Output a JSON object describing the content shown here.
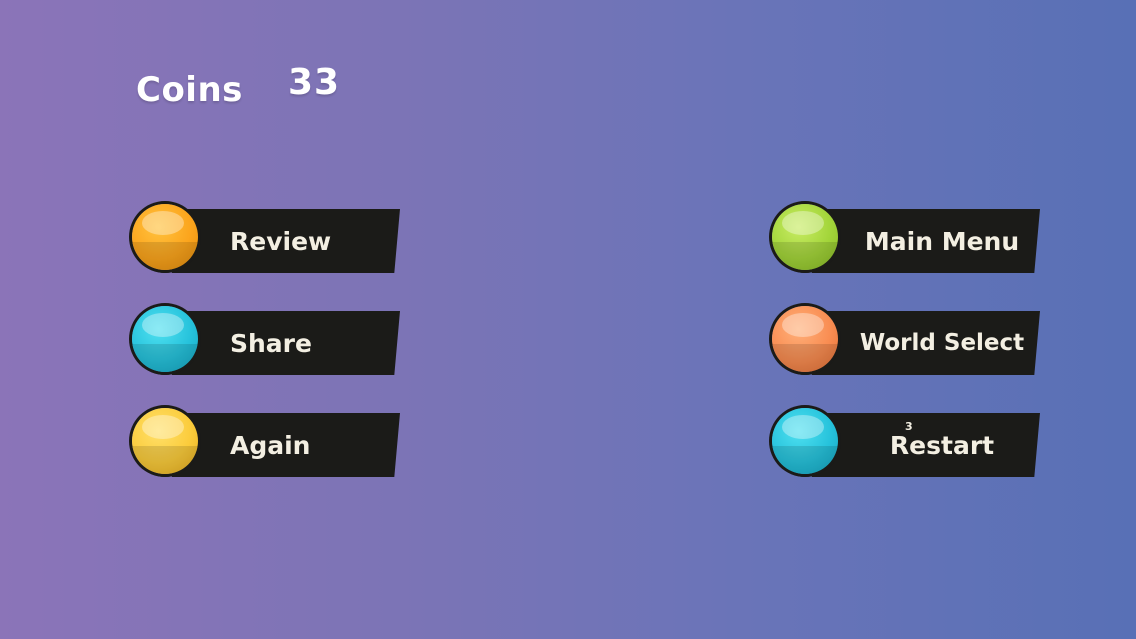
{
  "hud": {
    "coins_label": "Coins",
    "coins_value": "33"
  },
  "buttons": {
    "review": {
      "label": "Review",
      "color": "#fca51d"
    },
    "share": {
      "label": "Share",
      "color": "#27c3dc"
    },
    "again": {
      "label": "Again",
      "color": "#fbcc3c"
    },
    "main_menu": {
      "label": "Main Menu",
      "color": "#a3d53a"
    },
    "world_select": {
      "label": "World Select",
      "color": "#f98d52"
    },
    "restart": {
      "label": "Restart",
      "color": "#27c3dc",
      "badge": "3"
    }
  },
  "theme": {
    "plate_color": "#1b1b18",
    "text_color": "#f3efe2",
    "background_left": "#8b74b8",
    "background_right": "#5870b6"
  }
}
